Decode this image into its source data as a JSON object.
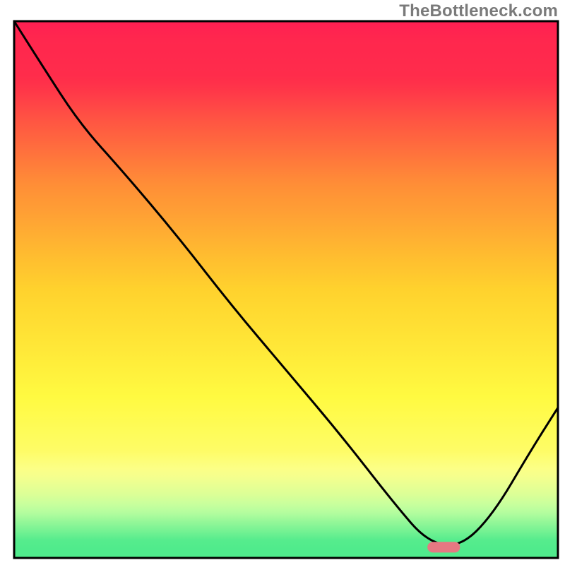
{
  "watermark": "TheBottleneck.com",
  "chart_data": {
    "type": "line",
    "title": "",
    "xlabel": "",
    "ylabel": "",
    "xlim": [
      0,
      100
    ],
    "ylim": [
      0,
      100
    ],
    "background_bands": [
      {
        "y_from": 100,
        "y_to": 98,
        "rgb": [
          255,
          30,
          82
        ]
      },
      {
        "y_from": 98,
        "y_to": 80,
        "rgb": [
          255,
          45,
          75
        ]
      },
      {
        "y_from": 80,
        "y_to": 60,
        "rgb": [
          255,
          140,
          55
        ]
      },
      {
        "y_from": 60,
        "y_to": 40,
        "rgb": [
          255,
          210,
          45
        ]
      },
      {
        "y_from": 40,
        "y_to": 20,
        "rgb": [
          255,
          250,
          65
        ]
      },
      {
        "y_from": 20,
        "y_to": 12,
        "rgb": [
          252,
          255,
          140
        ]
      },
      {
        "y_from": 12,
        "y_to": 6,
        "rgb": [
          190,
          255,
          160
        ]
      },
      {
        "y_from": 6,
        "y_to": 0,
        "rgb": [
          80,
          235,
          140
        ]
      }
    ],
    "series": [
      {
        "name": "bottleneck-curve",
        "x": [
          0,
          5,
          12,
          20,
          30,
          40,
          50,
          60,
          70,
          76,
          82,
          88,
          95,
          100
        ],
        "y": [
          100,
          92,
          81,
          72,
          60,
          47,
          35,
          23,
          10,
          3,
          2,
          8,
          20,
          28
        ]
      }
    ],
    "marker": {
      "name": "optimal-range",
      "x": 79,
      "y": 2,
      "width": 6,
      "height": 2,
      "rgb": [
        230,
        120,
        130
      ]
    }
  }
}
